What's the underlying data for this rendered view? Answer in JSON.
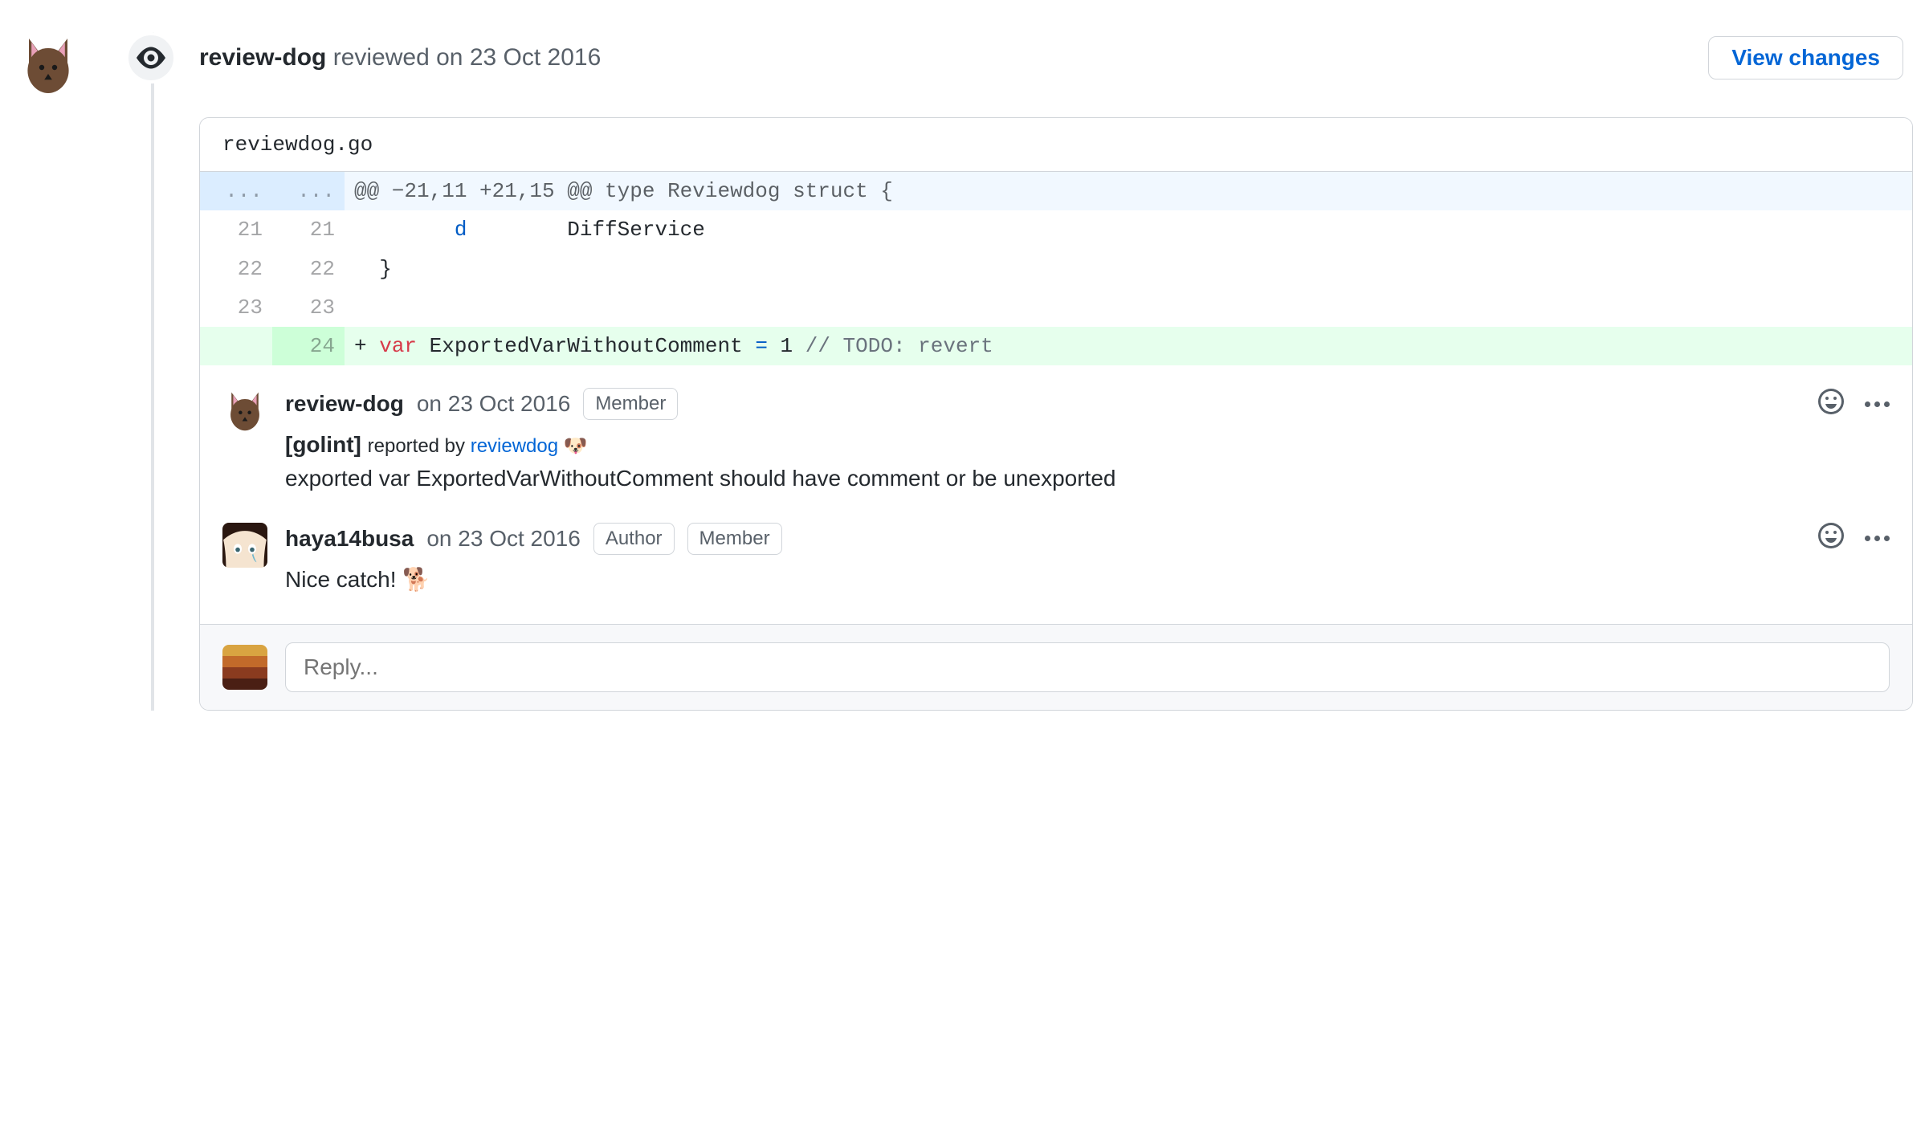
{
  "header": {
    "reviewer": "review-dog",
    "action": "reviewed",
    "date_prefix": "on",
    "date": "23 Oct 2016",
    "view_changes": "View changes"
  },
  "file": {
    "name": "reviewdog.go"
  },
  "diff": {
    "hunk_ellipsis_a": "...",
    "hunk_ellipsis_b": "...",
    "hunk_header": "@@ −21,11 +21,15 @@ type Reviewdog struct {",
    "rows": [
      {
        "old": "21",
        "new": "21",
        "code_pre": "        ",
        "tok": "d",
        "code_post": "        DiffService"
      },
      {
        "old": "22",
        "new": "22",
        "code_pre": "  }",
        "tok": "",
        "code_post": ""
      },
      {
        "old": "23",
        "new": "23",
        "code_pre": "",
        "tok": "",
        "code_post": ""
      }
    ],
    "added": {
      "new": "24",
      "plus": "+ ",
      "kw": "var",
      "mid": " ExportedVarWithoutComment ",
      "eq": "=",
      "val": " 1 ",
      "cmt": "// TODO: revert"
    }
  },
  "comments": [
    {
      "author": "review-dog",
      "date_prefix": "on",
      "date": "23 Oct 2016",
      "badges": [
        "Member"
      ],
      "msg_tool": "[golint]",
      "msg_reported_by": "reported by",
      "msg_link": "reviewdog",
      "msg_emoji": "🐶",
      "msg_body": "exported var ExportedVarWithoutComment should have comment or be unexported"
    },
    {
      "author": "haya14busa",
      "date_prefix": "on",
      "date": "23 Oct 2016",
      "badges": [
        "Author",
        "Member"
      ],
      "msg_body": "Nice catch!",
      "msg_emoji": "🐕"
    }
  ],
  "reply": {
    "placeholder": "Reply..."
  }
}
